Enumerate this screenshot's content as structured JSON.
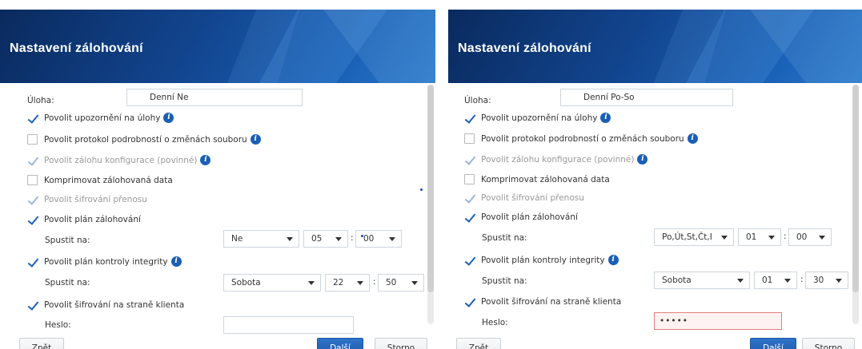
{
  "left": {
    "title": "Nastavení zálohování",
    "task_label": "Úloha:",
    "task_value": "Denní Ne",
    "options": {
      "notify": "Povolit upozornění na úlohy",
      "log": "Povolit protokol podrobností o změnách souboru",
      "config": "Povolit zálohu konfigurace (povinné)",
      "compress": "Komprimovat zálohovaná data",
      "transfer_enc": "Povolit šifrování přenosu",
      "schedule": "Povolit plán zálohování",
      "integrity": "Povolit plán kontroly integrity",
      "client_enc": "Povolit šifrování na straně klienta"
    },
    "schedule_run_label": "Spustit na:",
    "schedule_day": "Ne",
    "schedule_hour": "05",
    "schedule_minute": "00",
    "integrity_run_label": "Spustit na:",
    "integrity_day": "Sobota",
    "integrity_hour": "22",
    "integrity_minute": "50",
    "password_label": "Heslo:",
    "password_value": "",
    "back_button": "Zpět",
    "next_button": "Další",
    "cancel_button": "Storno"
  },
  "right": {
    "title": "Nastavení zálohování",
    "task_label": "Úloha:",
    "task_value": "Denní Po-So",
    "options": {
      "notify": "Povolit upozornění na úlohy",
      "log": "Povolit protokol podrobností o změnách souboru",
      "config": "Povolit zálohu konfigurace (povinné)",
      "compress": "Komprimovat zálohovaná data",
      "transfer_enc": "Povolit šifrování přenosu",
      "schedule": "Povolit plán zálohování",
      "integrity": "Povolit plán kontroly integrity",
      "client_enc": "Povolit šifrování na straně klienta"
    },
    "schedule_run_label": "Spustit na:",
    "schedule_day": "Po,Út,St,Čt,I",
    "schedule_hour": "01",
    "schedule_minute": "00",
    "integrity_run_label": "Spustit na:",
    "integrity_day": "Sobota",
    "integrity_hour": "01",
    "integrity_minute": "30",
    "password_label": "Heslo:",
    "password_value": "•••••",
    "back_button": "Zpět",
    "next_button": "Další",
    "cancel_button": "Storno"
  },
  "colors": {
    "header_dark": "#0a2a5e",
    "header_light": "#2a78c9",
    "accent": "#1b5fb8",
    "error_border": "#e08080"
  },
  "icons": {
    "info": "info-icon",
    "check": "checkmark-icon",
    "dropdown": "chevron-down-icon"
  }
}
